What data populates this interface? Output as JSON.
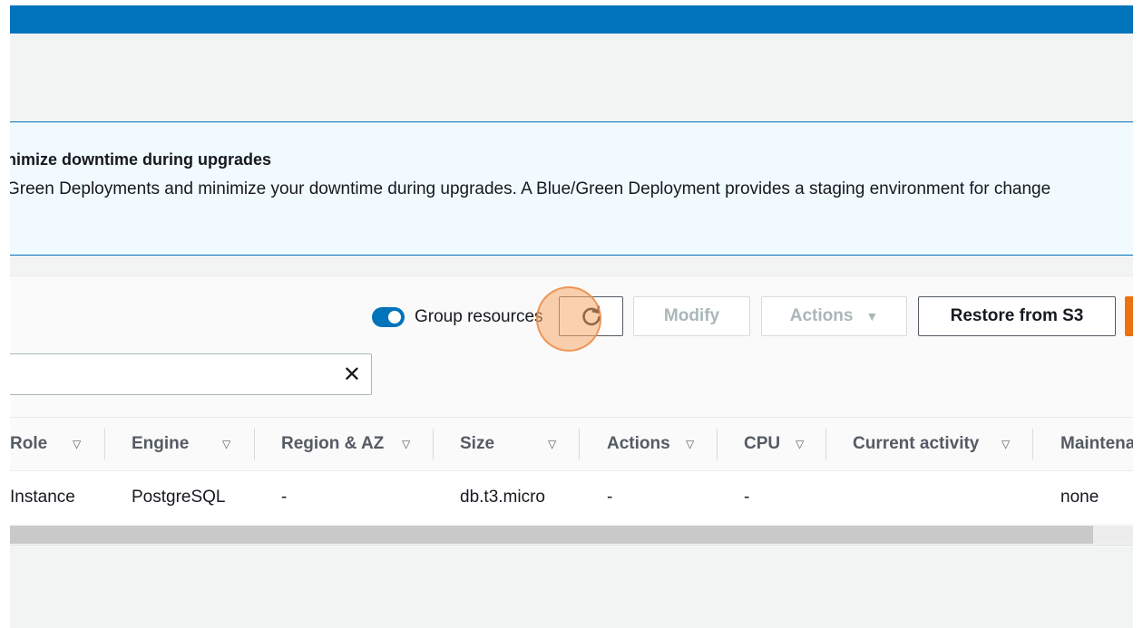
{
  "banner": {
    "title": "nimize downtime during upgrades",
    "text": "Green Deployments and minimize your downtime during upgrades. A Blue/Green Deployment provides a staging environment for change"
  },
  "toolbar": {
    "group_resources_label": "Group resources",
    "group_resources_on": true,
    "modify_label": "Modify",
    "actions_label": "Actions",
    "restore_label": "Restore from S3"
  },
  "search": {
    "value": ""
  },
  "table": {
    "headers": [
      "Role",
      "Engine",
      "Region & AZ",
      "Size",
      "Actions",
      "CPU",
      "Current activity",
      "Maintena"
    ],
    "row": [
      "Instance",
      "PostgreSQL",
      "-",
      "db.t3.micro",
      "-",
      "-",
      "",
      "none"
    ]
  },
  "colors": {
    "accent": "#0073bb",
    "primary_button": "#ec7211",
    "banner_bg": "#f1faff"
  },
  "icons": {
    "refresh": "refresh-icon",
    "clear": "close-icon",
    "sort": "sort-caret-icon"
  }
}
